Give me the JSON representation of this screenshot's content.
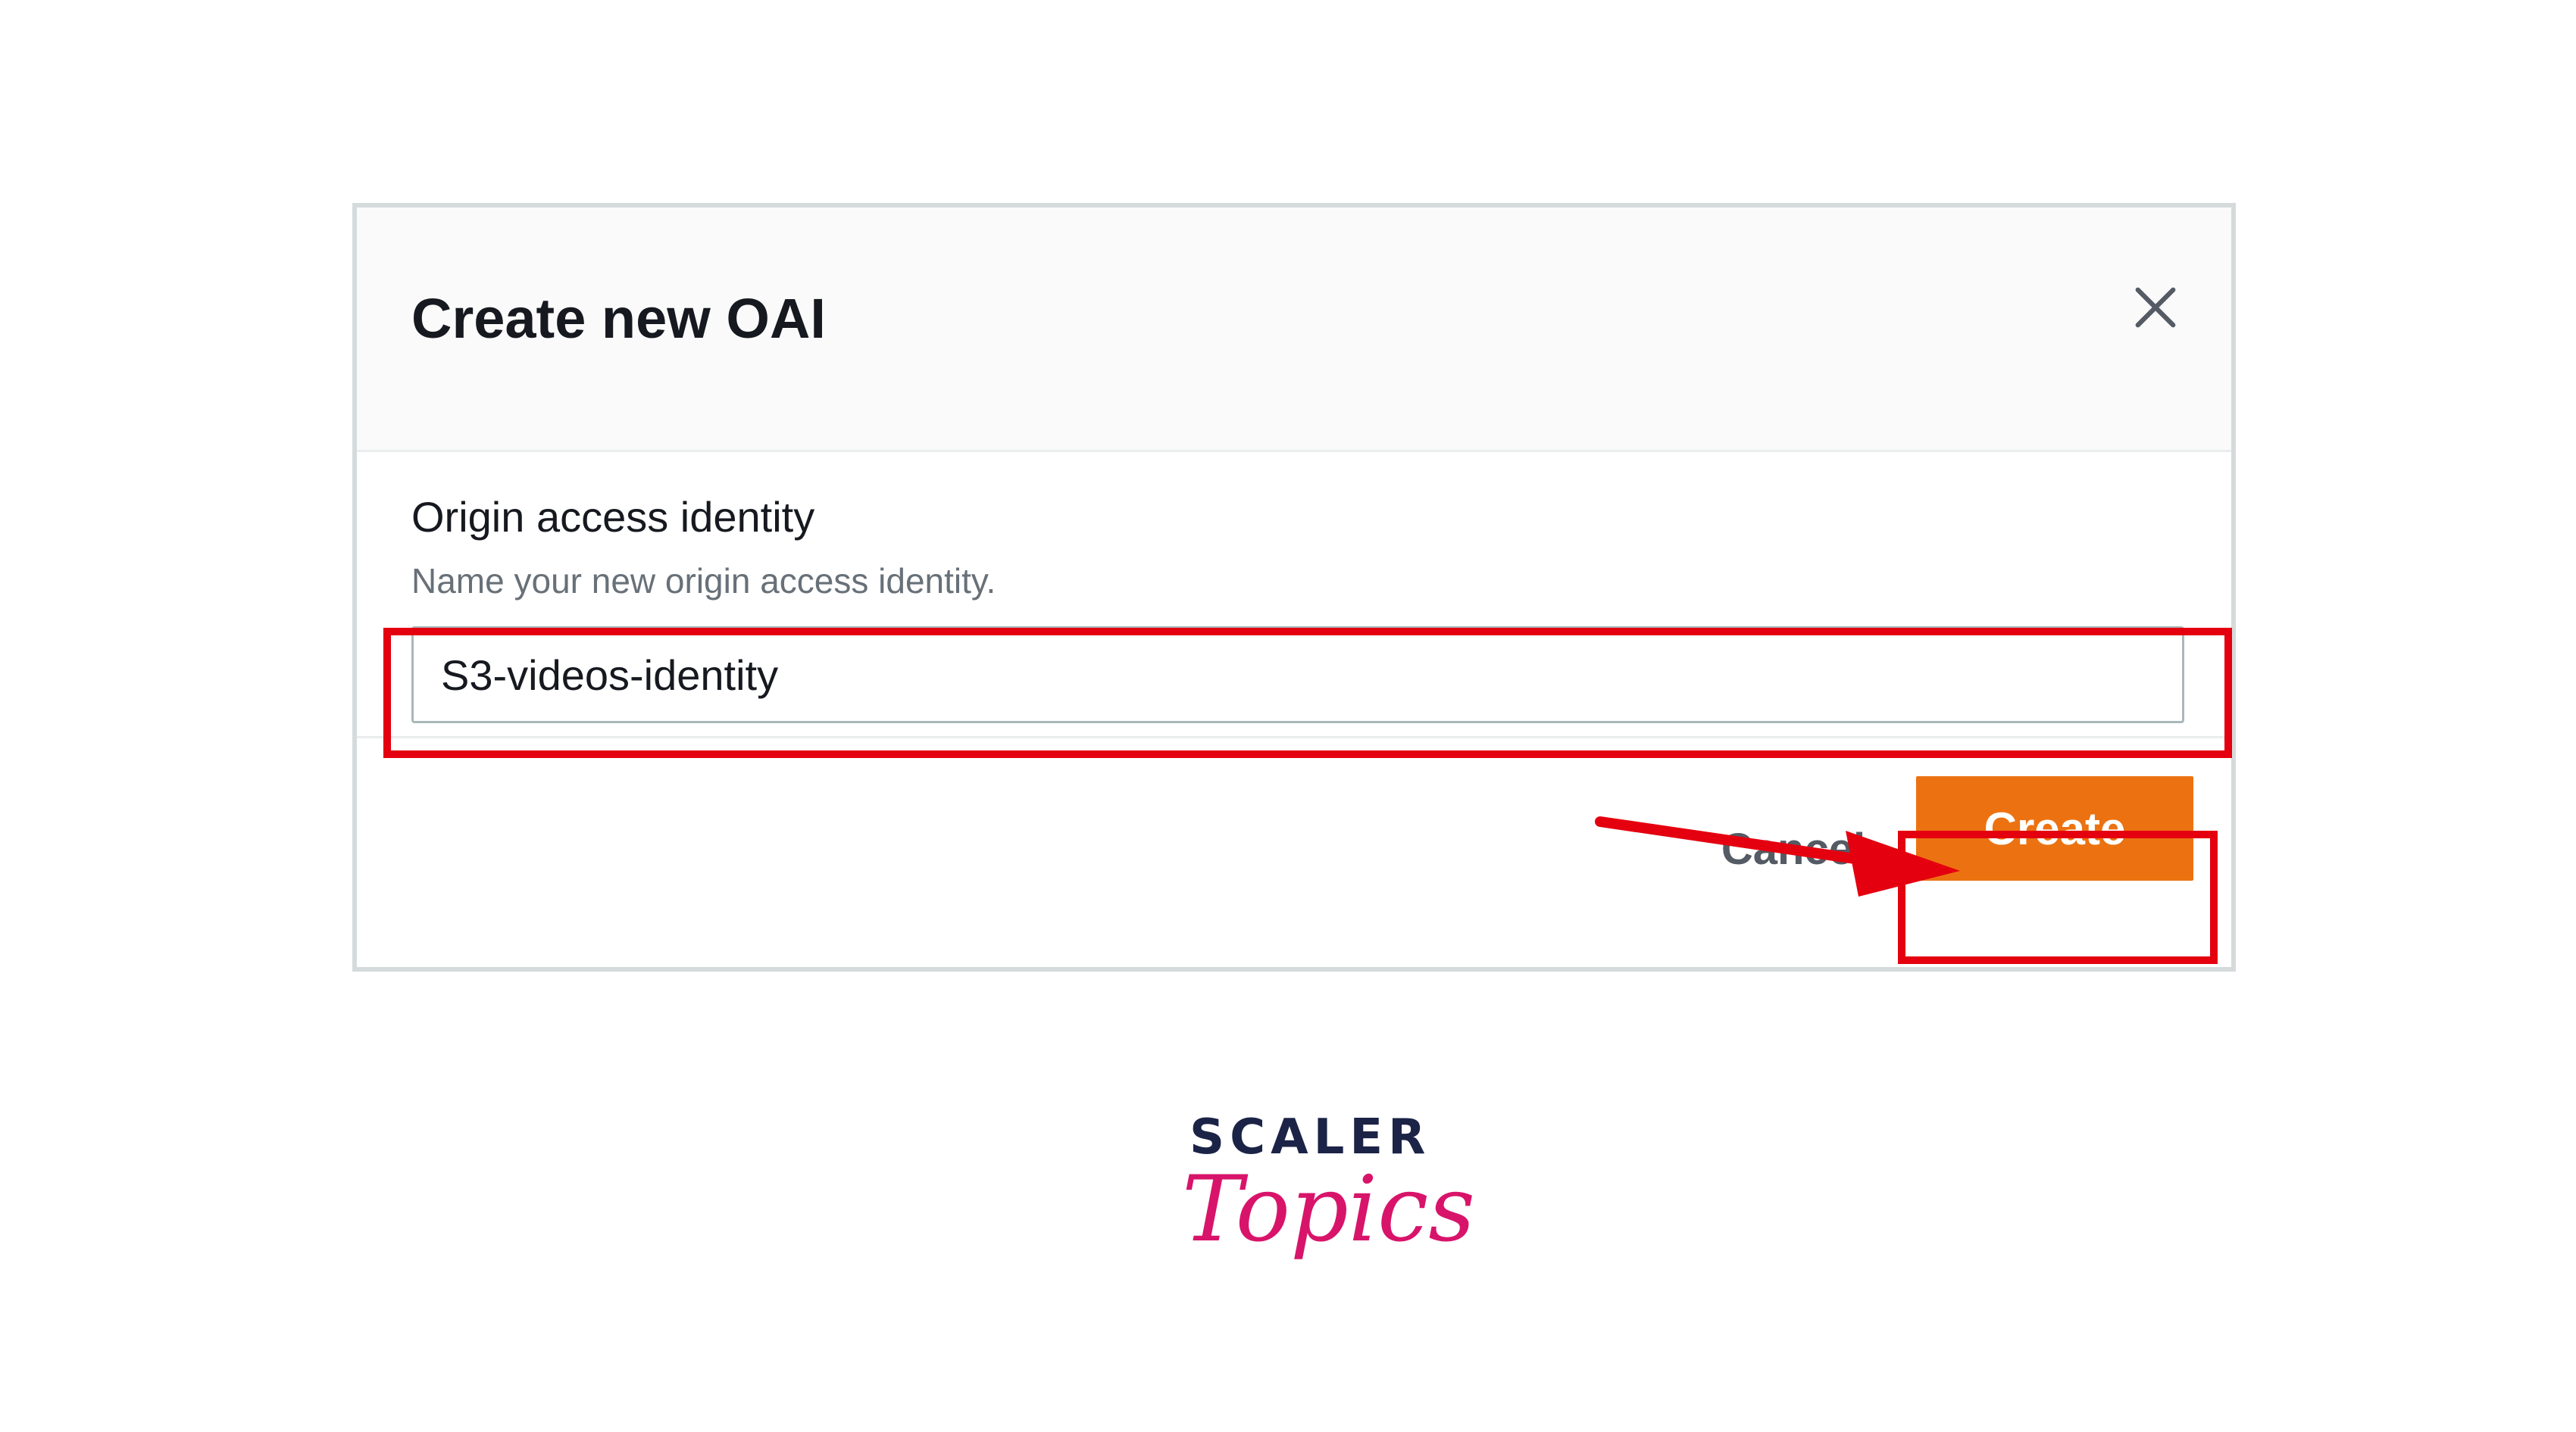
{
  "dialog": {
    "title": "Create new OAI",
    "close_icon": "close-icon"
  },
  "form": {
    "label": "Origin access identity",
    "description": "Name your new origin access identity.",
    "input_value": "S3-videos-identity"
  },
  "footer": {
    "cancel_label": "Cancel",
    "create_label": "Create"
  },
  "annotations": {
    "highlight_color": "#e4000f",
    "arrow_icon": "arrow-right-icon"
  },
  "logo": {
    "line1": "SCALER",
    "line2": "Topics"
  },
  "colors": {
    "primary_button": "#ec7211",
    "logo_navy": "#1b2346",
    "logo_pink": "#d8146a"
  }
}
